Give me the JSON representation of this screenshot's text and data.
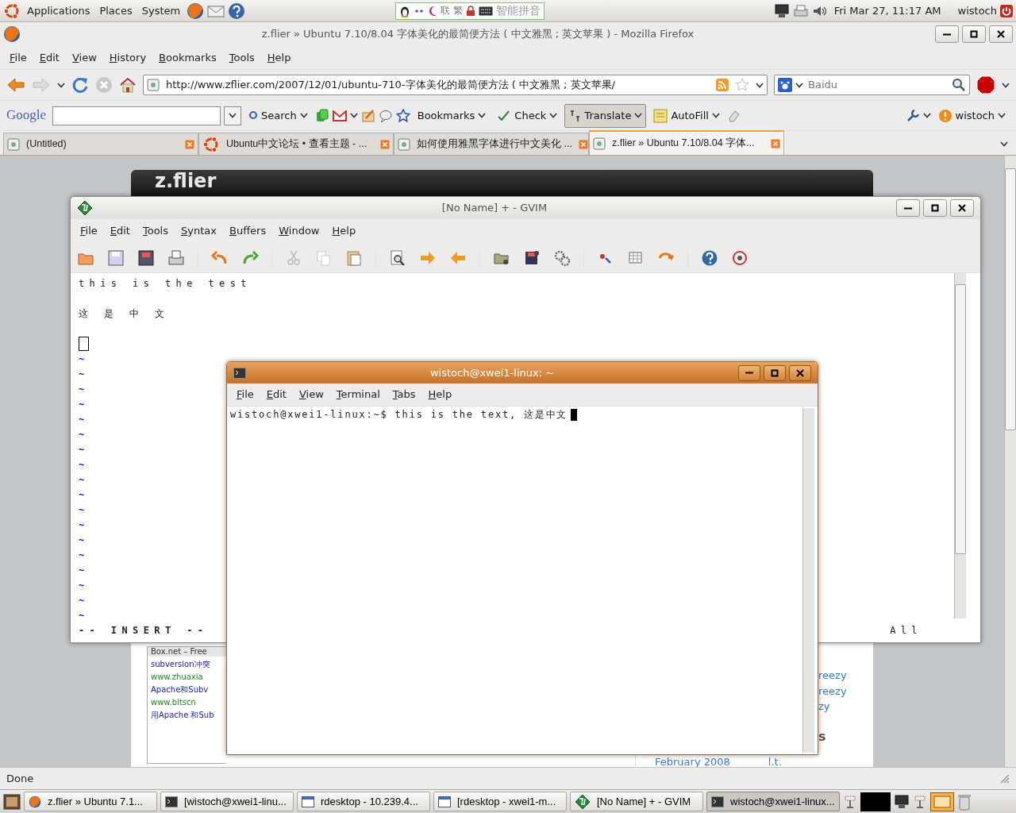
{
  "top_panel": {
    "menus": [
      "Applications",
      "Places",
      "System"
    ],
    "ime_labels": [
      "联",
      "繁"
    ],
    "ime_name": "智能拼音",
    "clock": "Fri Mar 27, 11:17 AM",
    "user": "wistoch"
  },
  "firefox": {
    "title": "z.flier » Ubuntu 7.10/8.04 字体美化的最简便方法 ( 中文雅黑 ; 英文苹果 ) - Mozilla Firefox",
    "menus": [
      "File",
      "Edit",
      "View",
      "History",
      "Bookmarks",
      "Tools",
      "Help"
    ],
    "url": "http://www.zflier.com/2007/12/01/ubuntu-710-字体美化的最简便方法 ( 中文雅黑 ; 英文苹果/",
    "search": {
      "placeholder": "Baidu"
    },
    "google_toolbar": {
      "logo": "Google",
      "buttons": [
        {
          "label": "Search",
          "pressed": false
        },
        {
          "label": "Bookmarks",
          "pressed": false
        },
        {
          "label": "Check",
          "pressed": false
        },
        {
          "label": "Translate",
          "pressed": true
        },
        {
          "label": "AutoFill",
          "pressed": false
        },
        {
          "label": "wistoch",
          "pressed": false
        }
      ]
    },
    "tabs": [
      {
        "label": "(Untitled)",
        "selected": false
      },
      {
        "label": "Ubuntu中文论坛 • 查看主题 - ...",
        "selected": false
      },
      {
        "label": "如何使用雅黑字体进行中文美化 ...",
        "selected": false
      },
      {
        "label": "z.flier » Ubuntu 7.10/8.04 字体...",
        "selected": true
      }
    ],
    "status_bar": "Done"
  },
  "page": {
    "logo": "z.flier",
    "snippet_lines": [
      {
        "text": "Box.net – Free",
        "kind": "title"
      },
      {
        "text": "subversion冲突",
        "kind": "link"
      },
      {
        "text": "www.zhuaxia",
        "kind": "url"
      },
      {
        "text": "Apache和Subv",
        "kind": "link"
      },
      {
        "text": "www.bitscn",
        "kind": "url"
      },
      {
        "text": "用Apache 和Sub",
        "kind": "link"
      }
    ],
    "sidebar_links": [
      "reezy",
      "reezy",
      "zy"
    ],
    "heading_fragment": "s",
    "archive": [
      "February 2008",
      "l.t."
    ]
  },
  "gvim": {
    "title": "[No Name] + - GVIM",
    "menus": [
      "File",
      "Edit",
      "Tools",
      "Syntax",
      "Buffers",
      "Window",
      "Help"
    ],
    "lines": [
      {
        "text": "this is the test",
        "cursor": false
      },
      {
        "cursor": false
      },
      {
        "text": "这 是 中 文",
        "cursor": false
      },
      {
        "cursor": false
      },
      {
        "cursor": true
      }
    ],
    "tildes": [
      "~",
      "~",
      "~",
      "~",
      "~",
      "~",
      "~",
      "~",
      "~",
      "~",
      "~",
      "~",
      "~",
      "~",
      "~",
      "~",
      "~",
      "~"
    ],
    "mode": "-- INSERT --",
    "ruler": "All"
  },
  "terminal": {
    "title": "wistoch@xwei1-linux: ~",
    "menus": [
      "File",
      "Edit",
      "View",
      "Terminal",
      "Tabs",
      "Help"
    ],
    "line": "wistoch@xwei1-linux:~$ this is the text, 这是中文"
  },
  "taskbar": [
    {
      "label": "z.flier » Ubuntu 7.1...",
      "kind": "browser",
      "selected": false
    },
    {
      "label": "[wistoch@xwei1-linu...",
      "kind": "terminal",
      "selected": false
    },
    {
      "label": "rdesktop - 10.239.4...",
      "kind": "window",
      "selected": false
    },
    {
      "label": "[rdesktop - xwei1-m...",
      "kind": "window",
      "selected": false
    },
    {
      "label": "[No Name] + - GVIM",
      "kind": "editor",
      "selected": false
    },
    {
      "label": "wistoch@xwei1-linux...",
      "kind": "terminal",
      "selected": true
    }
  ]
}
